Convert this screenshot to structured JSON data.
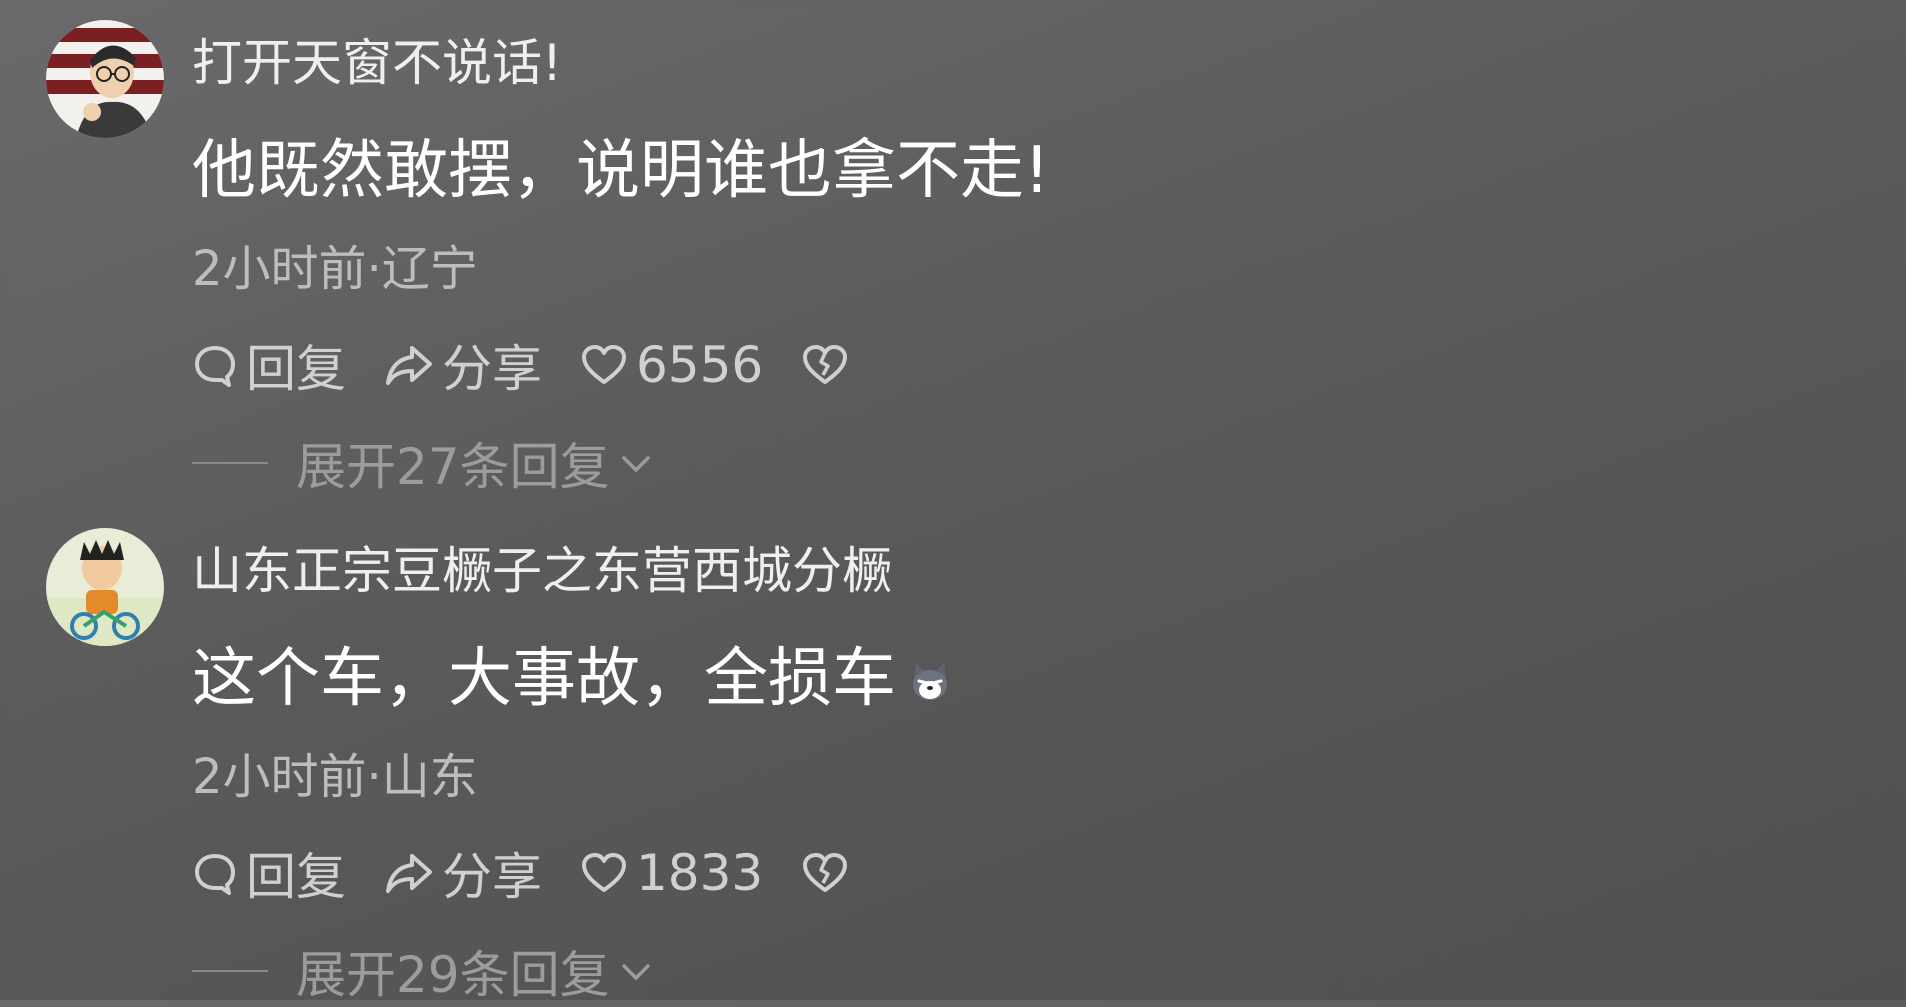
{
  "comments": [
    {
      "username": "打开天窗不说话!",
      "content": "他既然敢摆，说明谁也拿不走!",
      "meta": "2小时前·辽宁",
      "reply_label": "回复",
      "share_label": "分享",
      "like_count": "6556",
      "expand_label": "展开27条回复",
      "avatar_icon": "cartoon-man-glasses-avatar"
    },
    {
      "username": "山东正宗豆橛子之东营西城分橛",
      "content": "这个车，大事故，全损车",
      "meta": "2小时前·山东",
      "reply_label": "回复",
      "share_label": "分享",
      "like_count": "1833",
      "expand_label": "展开29条回复",
      "avatar_icon": "cartoon-kid-bike-avatar",
      "emoji_icon": "husky-dog-emoji"
    }
  ],
  "colors": {
    "background": "#5e5e5f",
    "text_primary": "#ffffff",
    "text_secondary": "#bdbdbd",
    "text_muted": "#9c9c9c"
  }
}
